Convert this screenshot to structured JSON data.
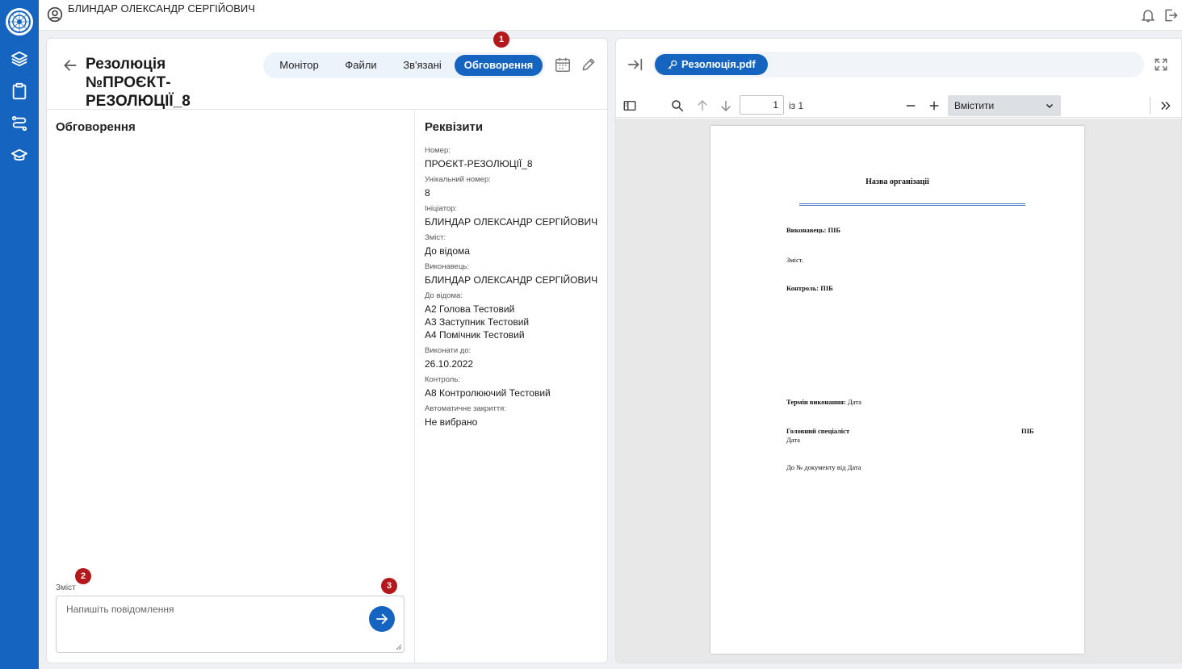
{
  "header": {
    "user_name": "БЛИНДАР ОЛЕКСАНДР СЕРГІЙОВИЧ"
  },
  "sidebar": {
    "items": [
      "layers-icon",
      "clipboard-icon",
      "routes-icon",
      "graduation-icon"
    ]
  },
  "document": {
    "title": "Резолюція №ПРОЄКТ-РЕЗОЛЮЦІЇ_8",
    "tabs": [
      {
        "label": "Монітор"
      },
      {
        "label": "Файли"
      },
      {
        "label": "Зв'язані"
      },
      {
        "label": "Обговорення",
        "active": true
      }
    ]
  },
  "badges": [
    "1",
    "2",
    "3"
  ],
  "discussion": {
    "title": "Обговорення",
    "field_label": "Зміст",
    "placeholder": "Напишіть повідомлення"
  },
  "requisites": {
    "title": "Реквізити",
    "items": [
      {
        "label": "Номер:",
        "values": [
          "ПРОЄКТ-РЕЗОЛЮЦІЇ_8"
        ]
      },
      {
        "label": "Унікальний номер:",
        "values": [
          "8"
        ]
      },
      {
        "label": "Ініціатор:",
        "values": [
          "БЛИНДАР ОЛЕКСАНДР СЕРГІЙОВИЧ"
        ]
      },
      {
        "label": "Зміст:",
        "values": [
          "До відома"
        ]
      },
      {
        "label": "Виконавець:",
        "values": [
          "БЛИНДАР ОЛЕКСАНДР СЕРГІЙОВИЧ"
        ]
      },
      {
        "label": "До відома:",
        "values": [
          "А2 Голова Тестовий",
          "А3 Заступник Тестовий",
          "А4 Помічник Тестовий"
        ]
      },
      {
        "label": "Виконати до:",
        "values": [
          "26.10.2022"
        ]
      },
      {
        "label": "Контроль:",
        "values": [
          "А8 Контролюючий Тестовий"
        ]
      },
      {
        "label": "Автоматичне закриття:",
        "values": [
          "Не вибрано"
        ]
      }
    ]
  },
  "viewer": {
    "file_name": "Резолюція.pdf",
    "page_current": "1",
    "page_total_label": "із 1",
    "zoom_label": "Вмістити"
  },
  "pdf": {
    "org": "Назва організації",
    "executor_label": "Виконавець:",
    "executor_value": "ПІБ",
    "content": "Зміст.",
    "control_label": "Контроль:",
    "control_value": "ПІБ",
    "deadline_label": "Термін виконання:",
    "deadline_value": "Дата",
    "position": "Головний спеціаліст",
    "signer": "ПІБ",
    "date": "Дата",
    "footer": "До № документу від Дата"
  },
  "colors": {
    "brand": "#1565c0",
    "badge": "#b3181d"
  }
}
